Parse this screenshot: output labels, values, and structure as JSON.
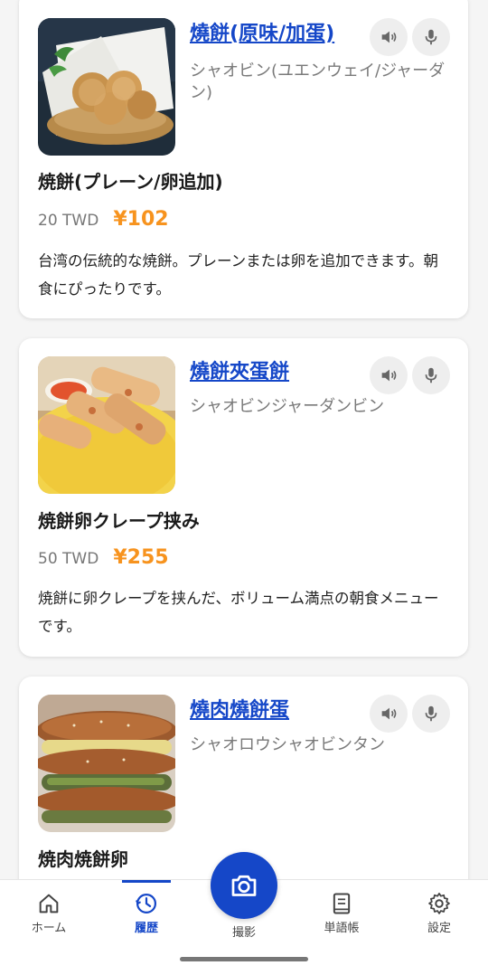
{
  "menu_items": [
    {
      "original_name": "燒餅(原味/加蛋)",
      "reading": "シャオビン(ユエンウェイ/ジャーダン)",
      "japanese_name": "焼餅(プレーン/卵追加)",
      "price_twd": "20 TWD",
      "price_jpy": "¥102",
      "description": "台湾の伝統的な焼餅。プレーンまたは卵を追加できます。朝食にぴったりです。"
    },
    {
      "original_name": "燒餅夾蛋餅",
      "reading": "シャオビンジャーダンビン",
      "japanese_name": "焼餅卵クレープ挟み",
      "price_twd": "50 TWD",
      "price_jpy": "¥255",
      "description": "焼餅に卵クレープを挟んだ、ボリューム満点の朝食メニューです。"
    },
    {
      "original_name": "燒肉燒餅蛋",
      "reading": "シャオロウシャオビンタン",
      "japanese_name": "焼肉焼餅卵",
      "price_twd": "",
      "price_jpy": "",
      "description": ""
    }
  ],
  "nav": {
    "home": "ホーム",
    "history": "履歴",
    "camera": "撮影",
    "vocab": "単語帳",
    "settings": "設定"
  },
  "colors": {
    "accent": "#1547c8",
    "price": "#f7931e"
  }
}
